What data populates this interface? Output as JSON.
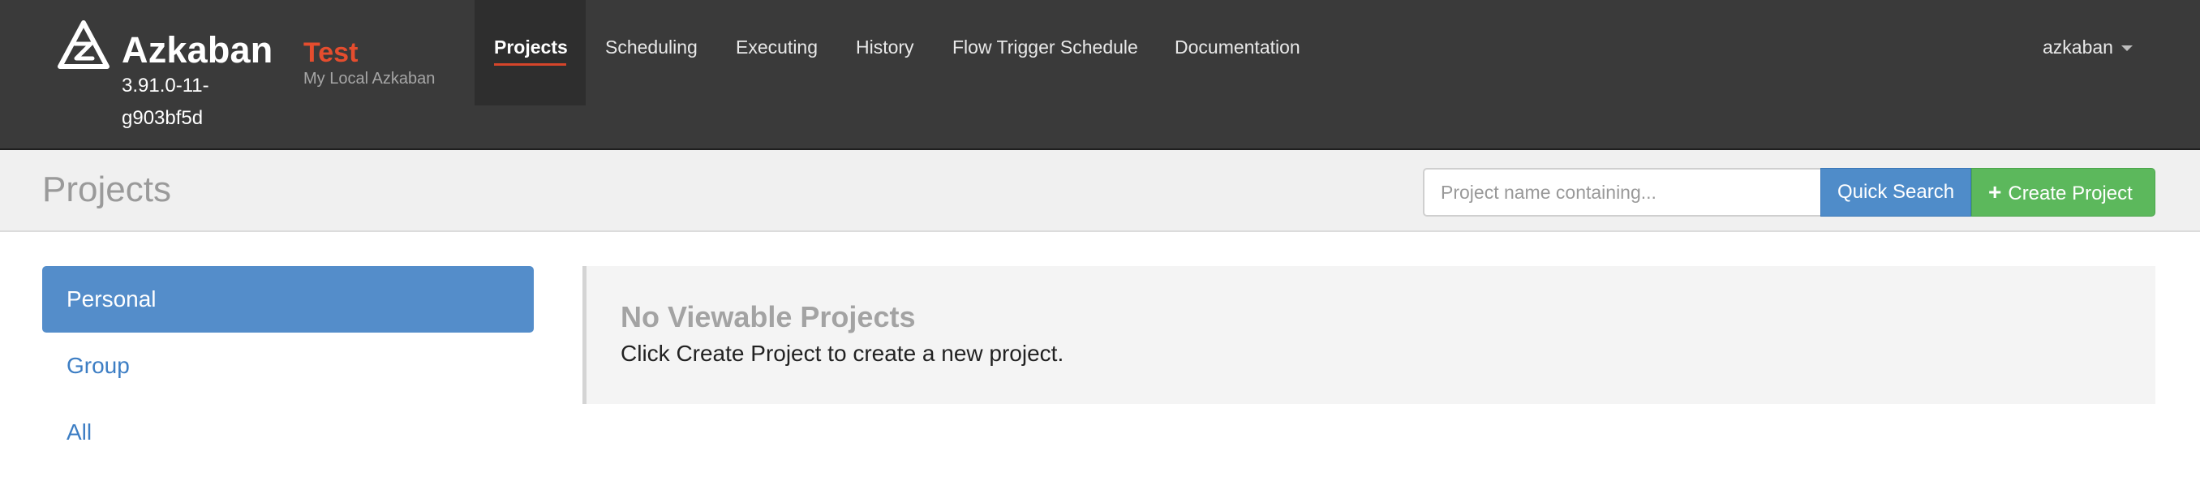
{
  "brand": {
    "name": "Azkaban",
    "version": "3.91.0-11-g903bf5d",
    "environment": "Test",
    "environment_description": "My Local Azkaban"
  },
  "nav": {
    "items": [
      {
        "label": "Projects",
        "active": true
      },
      {
        "label": "Scheduling",
        "active": false
      },
      {
        "label": "Executing",
        "active": false
      },
      {
        "label": "History",
        "active": false
      },
      {
        "label": "Flow Trigger Schedule",
        "active": false
      },
      {
        "label": "Documentation",
        "active": false
      }
    ],
    "user": "azkaban"
  },
  "header": {
    "title": "Projects",
    "search_placeholder": "Project name containing...",
    "search_value": "",
    "quick_search_label": "Quick Search",
    "create_project_label": "Create Project"
  },
  "sidebar": {
    "items": [
      {
        "label": "Personal",
        "active": true
      },
      {
        "label": "Group",
        "active": false
      },
      {
        "label": "All",
        "active": false
      }
    ]
  },
  "main": {
    "empty_title": "No Viewable Projects",
    "empty_text": "Click Create Project to create a new project."
  },
  "colors": {
    "navbar_bg": "#3a3a3a",
    "environment_accent": "#e54d2e",
    "primary": "#4f8cc9",
    "success": "#5cb85c",
    "link": "#3d7ec4"
  },
  "icons": {
    "logo": "azkaban-logo-icon",
    "user_dropdown": "caret-down-icon",
    "create": "plus-icon"
  }
}
